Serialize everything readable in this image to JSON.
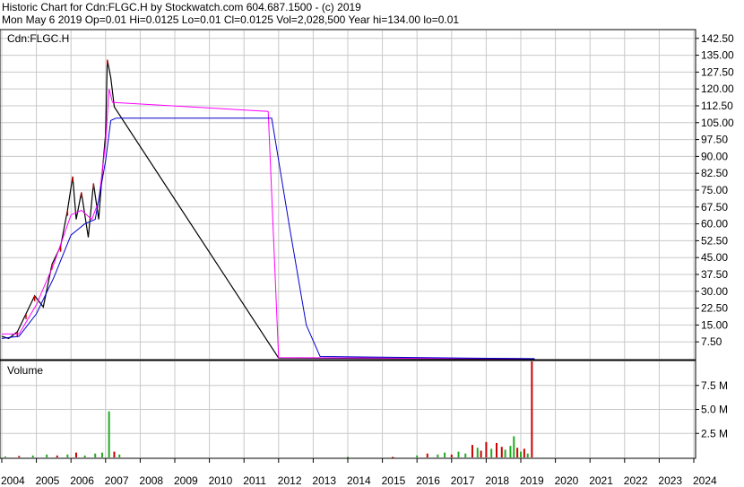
{
  "header": {
    "line1": "Historic Chart for Cdn:FLGC.H by Stockwatch.com 604.687.1500 - (c) 2019",
    "line2": "Mon May  6 2019   Op=0.01   Hi=0.0125   Lo=0.01    Cl=0.0125   Vol=2,028,500   Year hi=134.00   lo=0.01"
  },
  "colors": {
    "price": "#000000",
    "up_tick": "#cc0000",
    "ma_short": "#ff00ff",
    "ma_long": "#0000cc",
    "vol_up": "#22aa22",
    "vol_down": "#cc0000",
    "grid": "#c8c8c8"
  },
  "chart_data": [
    {
      "type": "line",
      "title": "Cdn:FLGC.H",
      "ylim": [
        0,
        146
      ],
      "y_ticks": [
        "142.50",
        "135.00",
        "127.50",
        "120.00",
        "112.50",
        "105.00",
        "97.50",
        "90.00",
        "82.50",
        "75.00",
        "67.50",
        "60.00",
        "52.50",
        "45.00",
        "37.50",
        "30.00",
        "22.50",
        "15.00",
        "7.50"
      ],
      "x_ticks": [
        "2004",
        "2005",
        "2006",
        "2007",
        "2008",
        "2009",
        "2010",
        "2011",
        "2012",
        "2013",
        "2014",
        "2015",
        "2016",
        "2017",
        "2018",
        "2019",
        "2020",
        "2021",
        "2022",
        "2023",
        "2024"
      ],
      "grid": true,
      "series": [
        {
          "key": "price",
          "x": [
            2004.0,
            2004.2,
            2004.45,
            2004.7,
            2004.95,
            2005.2,
            2005.45,
            2005.7,
            2005.9,
            2006.05,
            2006.15,
            2006.3,
            2006.5,
            2006.65,
            2006.8,
            2006.9,
            2007.0,
            2007.05,
            2007.15,
            2007.25,
            2012.0,
            2019.4
          ],
          "y": [
            10,
            9,
            12,
            20,
            28,
            23,
            42,
            50,
            66,
            81,
            62,
            74,
            54,
            78,
            62,
            82,
            100,
            133,
            125,
            112,
            0.3,
            0.01
          ]
        },
        {
          "key": "ma_short",
          "x": [
            2004.0,
            2004.5,
            2005.0,
            2005.5,
            2006.0,
            2006.3,
            2006.6,
            2006.8,
            2007.0,
            2007.1,
            2007.2,
            2011.7,
            2012.0,
            2019.4
          ],
          "y": [
            11,
            11,
            24,
            42,
            64,
            66,
            62,
            70,
            96,
            120,
            114,
            110,
            0.5,
            0.01
          ]
        },
        {
          "key": "ma_long",
          "x": [
            2004.0,
            2004.5,
            2005.0,
            2005.5,
            2006.0,
            2006.4,
            2006.7,
            2007.0,
            2007.15,
            2007.3,
            2011.8,
            2012.3,
            2012.8,
            2013.2,
            2019.4
          ],
          "y": [
            9,
            10,
            20,
            36,
            55,
            60,
            62,
            88,
            106,
            107,
            107,
            60,
            15,
            1,
            0.01
          ]
        }
      ]
    },
    {
      "type": "bar",
      "title": "Volume",
      "ylim": [
        0,
        10
      ],
      "y_ticks": [
        "7.5 M",
        "5.0 M",
        "2.5 M"
      ],
      "bars": [
        {
          "x": 2004.1,
          "v": 0.1,
          "dir": "up"
        },
        {
          "x": 2004.5,
          "v": 0.15,
          "dir": "down"
        },
        {
          "x": 2004.9,
          "v": 0.2,
          "dir": "up"
        },
        {
          "x": 2005.3,
          "v": 0.3,
          "dir": "up"
        },
        {
          "x": 2005.6,
          "v": 0.2,
          "dir": "down"
        },
        {
          "x": 2005.9,
          "v": 0.3,
          "dir": "up"
        },
        {
          "x": 2006.15,
          "v": 0.5,
          "dir": "down"
        },
        {
          "x": 2006.4,
          "v": 0.2,
          "dir": "up"
        },
        {
          "x": 2006.7,
          "v": 0.4,
          "dir": "up"
        },
        {
          "x": 2006.9,
          "v": 0.5,
          "dir": "up"
        },
        {
          "x": 2007.1,
          "v": 4.8,
          "dir": "up"
        },
        {
          "x": 2007.25,
          "v": 0.6,
          "dir": "down"
        },
        {
          "x": 2007.4,
          "v": 0.3,
          "dir": "up"
        },
        {
          "x": 2014.0,
          "v": 0.05,
          "dir": "up"
        },
        {
          "x": 2015.3,
          "v": 0.05,
          "dir": "down"
        },
        {
          "x": 2016.0,
          "v": 0.2,
          "dir": "up"
        },
        {
          "x": 2016.3,
          "v": 0.4,
          "dir": "down"
        },
        {
          "x": 2016.6,
          "v": 0.3,
          "dir": "up"
        },
        {
          "x": 2016.8,
          "v": 0.5,
          "dir": "up"
        },
        {
          "x": 2017.0,
          "v": 0.3,
          "dir": "down"
        },
        {
          "x": 2017.2,
          "v": 0.6,
          "dir": "up"
        },
        {
          "x": 2017.4,
          "v": 0.4,
          "dir": "up"
        },
        {
          "x": 2017.6,
          "v": 1.3,
          "dir": "down"
        },
        {
          "x": 2017.75,
          "v": 1.0,
          "dir": "up"
        },
        {
          "x": 2017.85,
          "v": 0.7,
          "dir": "down"
        },
        {
          "x": 2018.0,
          "v": 1.6,
          "dir": "down"
        },
        {
          "x": 2018.15,
          "v": 0.9,
          "dir": "up"
        },
        {
          "x": 2018.3,
          "v": 1.5,
          "dir": "down"
        },
        {
          "x": 2018.45,
          "v": 1.1,
          "dir": "down"
        },
        {
          "x": 2018.55,
          "v": 0.8,
          "dir": "up"
        },
        {
          "x": 2018.7,
          "v": 1.2,
          "dir": "up"
        },
        {
          "x": 2018.8,
          "v": 2.2,
          "dir": "up"
        },
        {
          "x": 2018.9,
          "v": 1.0,
          "dir": "down"
        },
        {
          "x": 2019.0,
          "v": 0.6,
          "dir": "up"
        },
        {
          "x": 2019.1,
          "v": 0.9,
          "dir": "down"
        },
        {
          "x": 2019.2,
          "v": 0.4,
          "dir": "up"
        },
        {
          "x": 2019.32,
          "v": 10.3,
          "dir": "down"
        }
      ]
    }
  ]
}
